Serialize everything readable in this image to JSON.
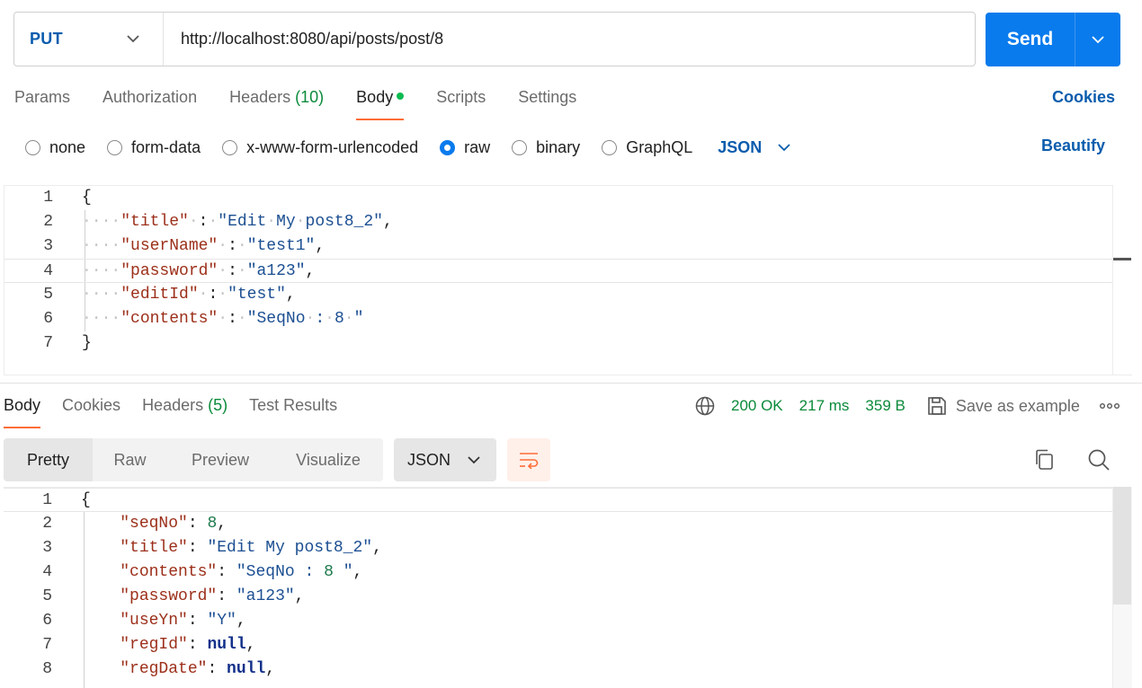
{
  "request": {
    "method": "PUT",
    "url": "http://localhost:8080/api/posts/post/8",
    "send_label": "Send"
  },
  "request_tabs": [
    {
      "label": "Params"
    },
    {
      "label": "Authorization"
    },
    {
      "label": "Headers",
      "count": "(10)"
    },
    {
      "label": "Body",
      "active": true
    },
    {
      "label": "Scripts"
    },
    {
      "label": "Settings"
    }
  ],
  "cookies_link": "Cookies",
  "body_types": [
    "none",
    "form-data",
    "x-www-form-urlencoded",
    "raw",
    "binary",
    "GraphQL"
  ],
  "body_type_selected": "raw",
  "body_format": "JSON",
  "beautify_label": "Beautify",
  "request_body_lines": [
    "{",
    "    \"title\" : \"Edit My post8_2\",",
    "    \"userName\" : \"test1\",",
    "    \"password\" : \"a123\",",
    "    \"editId\" : \"test\",",
    "    \"contents\" : \"SeqNo : 8 \"",
    "}"
  ],
  "response_tabs": [
    {
      "label": "Body",
      "active": true
    },
    {
      "label": "Cookies"
    },
    {
      "label": "Headers",
      "count": "(5)"
    },
    {
      "label": "Test Results"
    }
  ],
  "response_status": {
    "status": "200 OK",
    "time": "217 ms",
    "size": "359 B",
    "save_label": "Save as example"
  },
  "view_modes": [
    "Pretty",
    "Raw",
    "Preview",
    "Visualize"
  ],
  "view_mode_selected": "Pretty",
  "response_format": "JSON",
  "response_body_lines": [
    "{",
    "    \"seqNo\": 8,",
    "    \"title\": \"Edit My post8_2\",",
    "    \"contents\": \"SeqNo : 8 \",",
    "    \"password\": \"a123\",",
    "    \"useYn\": \"Y\",",
    "    \"regId\": null,",
    "    \"regDate\": null,"
  ],
  "colors": {
    "accent": "#097bed",
    "method": "#0b5cad",
    "active_tab_underline": "#ff6c37",
    "success": "#0b8a3a",
    "json_key": "#9c2f1a",
    "json_string": "#1c4f92"
  }
}
